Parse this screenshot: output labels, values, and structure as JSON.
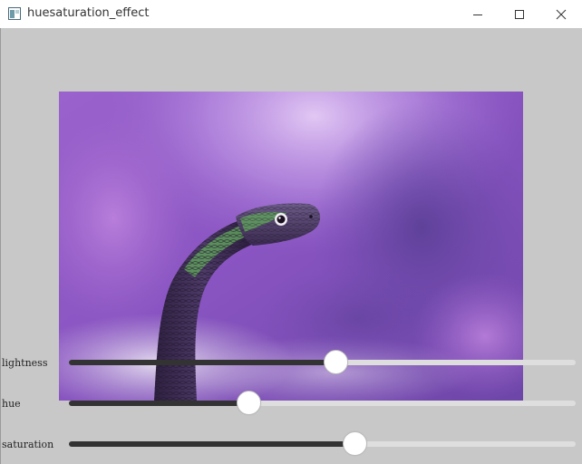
{
  "window": {
    "title": "huesaturation_effect",
    "icon": "app-window-icon",
    "controls": [
      "minimize-icon",
      "maximize-icon",
      "close-icon"
    ]
  },
  "image": {
    "subject": "snake-photo",
    "colors": {
      "background_purple": "#8e5bc4",
      "snake_green": "#5fa060",
      "snake_body": "#3d2a55"
    }
  },
  "sliders": [
    {
      "label": "lightness",
      "value": 0.528
    },
    {
      "label": "hue",
      "value": 0.356
    },
    {
      "label": "saturation",
      "value": 0.566
    }
  ],
  "colors": {
    "background": "#c8c8c8",
    "track": "#dedede",
    "track_fill": "#333333",
    "thumb": "#ffffff"
  }
}
